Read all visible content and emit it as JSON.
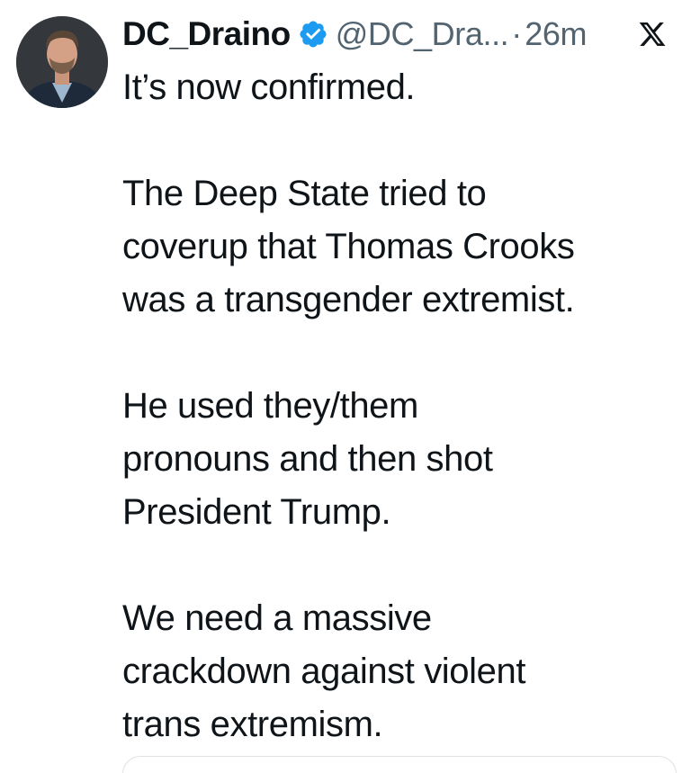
{
  "tweet": {
    "author": {
      "display_name": "DC_Draino",
      "handle": "@DC_Dra...",
      "verified": true
    },
    "separator": "·",
    "timestamp": "26m",
    "paragraphs": [
      "It’s now confirmed.",
      "The Deep State tried to\ncoverup that Thomas Crooks\nwas a transgender extremist.",
      "He used they/them\npronouns and then shot\nPresident Trump.",
      "We need a massive\ncrackdown against violent\ntrans extremism."
    ]
  },
  "icons": {
    "verified": "verified-badge-icon",
    "platform": "x-logo-icon"
  },
  "colors": {
    "text": "#0f1419",
    "secondary": "#536471",
    "verified": "#1d9bf0",
    "background": "#ffffff"
  }
}
